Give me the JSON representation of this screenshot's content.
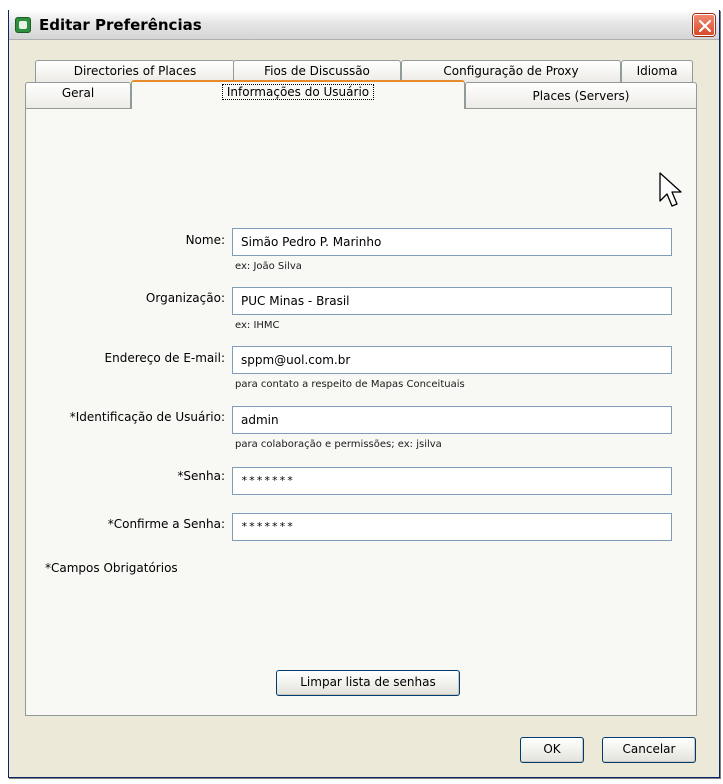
{
  "window": {
    "title": "Editar Preferências",
    "icons": {
      "app": "app-logo-icon",
      "close": "close-icon"
    }
  },
  "tabs": {
    "row_back": [
      {
        "label": "Directories of Places"
      },
      {
        "label": "Fios de Discussão"
      },
      {
        "label": "Configuração de Proxy"
      },
      {
        "label": "Idioma"
      }
    ],
    "row_front": [
      {
        "label": "Geral"
      },
      {
        "label": "Informações do Usuário",
        "active": true
      },
      {
        "label": "Places (Servers)"
      }
    ]
  },
  "form": {
    "name": {
      "label": "Nome:",
      "value": "Simão Pedro P. Marinho",
      "hint": "ex: João Silva"
    },
    "organization": {
      "label": "Organização:",
      "value": "PUC Minas - Brasil",
      "hint": "ex: IHMC"
    },
    "email": {
      "label": "Endereço de E-mail:",
      "value": "sppm@uol.com.br",
      "hint": "para contato a respeito de Mapas Conceituais"
    },
    "user_id": {
      "label": "*Identificação de Usuário:",
      "value": "admin",
      "hint": "para colaboração e permissões; ex: jsilva"
    },
    "password": {
      "label": "*Senha:",
      "value": "*******"
    },
    "confirm_password": {
      "label": "*Confirme a Senha:",
      "value": "*******"
    },
    "required_note": "*Campos Obrigatórios",
    "clear_passwords_button": "Limpar lista de senhas"
  },
  "footer": {
    "ok_button": "OK",
    "cancel_button": "Cancelar"
  },
  "colors": {
    "dialog_background": "#ece9d8",
    "panel_background": "#f8f8f5",
    "active_tab_accent": "#e68b2c",
    "field_border": "#7f9db9",
    "close_button": "#d84a2a"
  }
}
